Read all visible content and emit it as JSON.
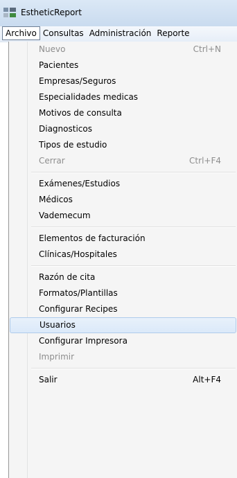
{
  "window": {
    "title": "EstheticReport"
  },
  "menubar": [
    {
      "label": "Archivo",
      "active": true
    },
    {
      "label": "Consultas"
    },
    {
      "label": "Administración"
    },
    {
      "label": "Reporte"
    }
  ],
  "menu": [
    {
      "type": "item",
      "label": "Nuevo",
      "shortcut": "Ctrl+N",
      "disabled": true
    },
    {
      "type": "item",
      "label": "Pacientes"
    },
    {
      "type": "item",
      "label": "Empresas/Seguros"
    },
    {
      "type": "item",
      "label": "Especialidades medicas"
    },
    {
      "type": "item",
      "label": "Motivos de consulta"
    },
    {
      "type": "item",
      "label": "Diagnosticos"
    },
    {
      "type": "item",
      "label": "Tipos de estudio"
    },
    {
      "type": "item",
      "label": "Cerrar",
      "shortcut": "Ctrl+F4",
      "disabled": true
    },
    {
      "type": "separator"
    },
    {
      "type": "item",
      "label": "Exámenes/Estudios"
    },
    {
      "type": "item",
      "label": "Médicos"
    },
    {
      "type": "item",
      "label": "Vademecum"
    },
    {
      "type": "separator"
    },
    {
      "type": "item",
      "label": "Elementos de facturación"
    },
    {
      "type": "item",
      "label": "Clínicas/Hospitales"
    },
    {
      "type": "separator"
    },
    {
      "type": "item",
      "label": "Razón de cita"
    },
    {
      "type": "item",
      "label": "Formatos/Plantillas"
    },
    {
      "type": "item",
      "label": "Configurar Recipes"
    },
    {
      "type": "item",
      "label": "Usuarios",
      "highlighted": true
    },
    {
      "type": "item",
      "label": "Configurar Impresora"
    },
    {
      "type": "item",
      "label": "Imprimir",
      "disabled": true
    },
    {
      "type": "separator"
    },
    {
      "type": "item",
      "label": "Salir",
      "shortcut": "Alt+F4"
    }
  ]
}
